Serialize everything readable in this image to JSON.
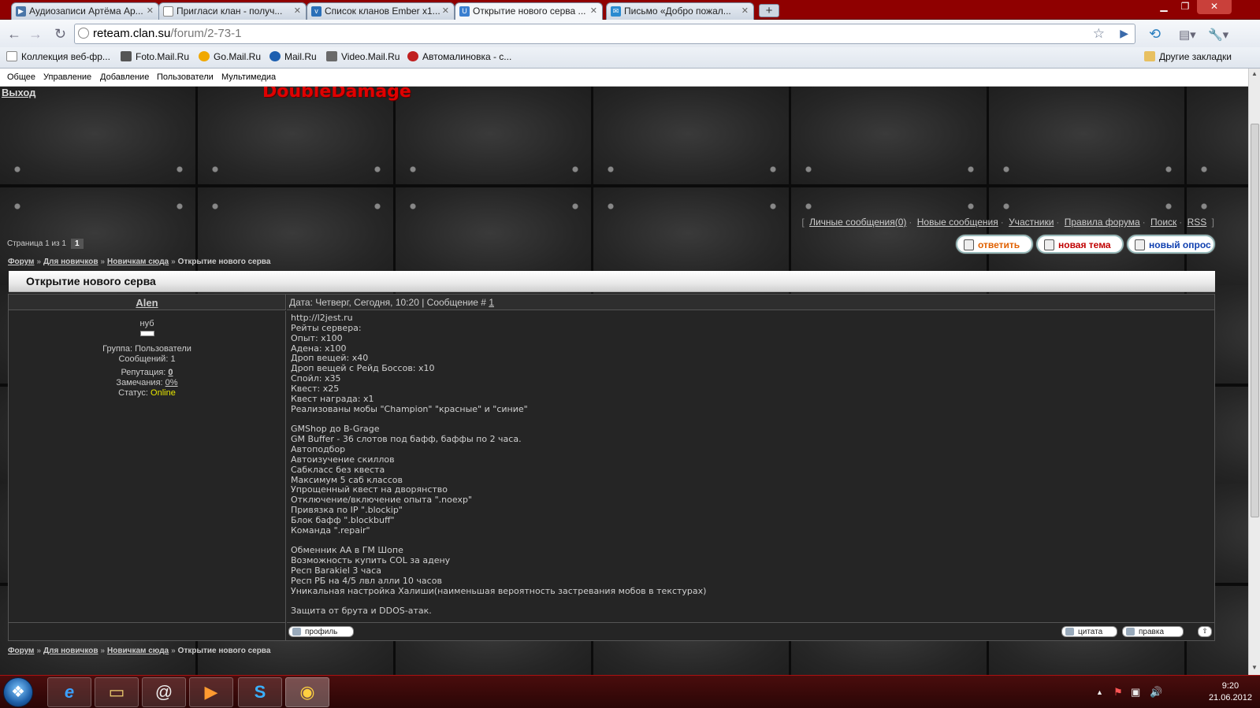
{
  "browser": {
    "tabs": [
      {
        "title": "Аудиозаписи Артёма Ар...",
        "icon": "vk-audio-icon",
        "color": "#4a76a8"
      },
      {
        "title": "Пригласи клан - получ...",
        "icon": "page-icon",
        "color": "#888888"
      },
      {
        "title": "Список кланов Ember x1...",
        "icon": "clan-icon",
        "color": "#2a6fb8"
      },
      {
        "title": "Открытие нового серва ...",
        "icon": "ucoz-icon",
        "color": "#3a7fd0"
      },
      {
        "title": "Письмо «Добро пожал...",
        "icon": "mail-icon",
        "color": "#2a8ad0"
      }
    ],
    "url_host": "reteam.clan.su",
    "url_path": "/forum/2-73-1",
    "bookmarks": [
      "Коллекция веб-фр...",
      "Foto.Mail.Ru",
      "Go.Mail.Ru",
      "Mail.Ru",
      "Video.Mail.Ru",
      "Автомалиновка - с..."
    ],
    "other_bookmarks": "Другие закладки"
  },
  "adminbar": {
    "items": [
      "Общее",
      "Управление",
      "Добавление",
      "Пользователи",
      "Мультимедиа"
    ]
  },
  "site": {
    "logout": "Выход",
    "title": "DoubleDamage",
    "userlinks": [
      "Личные сообщения(0)",
      "Новые сообщения",
      "Участники",
      "Правила форума",
      "Поиск",
      "RSS"
    ],
    "pager_label": "Страница 1 из 1",
    "pager_current": "1",
    "buttons": {
      "reply": "ответить",
      "new_topic": "новая тема",
      "new_poll": "новый опрос"
    },
    "breadcrumbs": [
      "Форум",
      "Для новичков",
      "Новичкам сюда",
      "Открытие нового серва"
    ]
  },
  "thread": {
    "title": "Открытие нового серва",
    "post": {
      "author": "Alen",
      "rank": "нуб",
      "group": "Группа: Пользователи",
      "messages": "Сообщений: 1",
      "reputation_label": "Репутация:",
      "reputation_value": "0",
      "warnings_label": "Замечания:",
      "warnings_value": "0%",
      "status_label": "Статус:",
      "status_value": "Online",
      "date_label": "Дата: Четверг, Сегодня, 10:20 | Сообщение #",
      "message_num": "1",
      "body": "http://l2jest.ru\nРейты сервера:\nОпыт: x100\nАдена: x100\nДроп вещей: x40\nДроп вещей с Рейд Боссов: x10\nСпойл: x35\nКвест: x25\nКвест награда: x1\nРеализованы мобы \"Champion\" \"красные\" и \"синие\"\n\nGMShop до B-Grage\nGM Buffer - 36 слотов под бафф, баффы по 2 часа.\nАвтоподбор\nАвтоизучение скиллов\nСабкласс без квеста\nМаксимум 5 саб классов\nУпрощенный квест на дворянство\nОтключение/включение опыта \".noexp\"\nПривязка по IP \".blockip\"\nБлок бафф \".blockbuff\"\nКоманда \".repair\"\n\nОбменник АА в ГМ Шопе\nВозможность купить COL за адену\nРесп Barakiel 3 часа\nРесп РБ на 4/5 лвл алли 10 часов\nУникальная настройка Халиши(наименьшая вероятность застревания мобов в текстурах)\n\nЗащита от брута и DDOS-атак.",
      "profile_btn": "профиль",
      "quote_btn": "цитата",
      "edit_btn": "правка"
    }
  },
  "taskbar": {
    "apps": [
      "internet-explorer-icon",
      "explorer-folder-icon",
      "mail-agent-icon",
      "media-player-icon",
      "skype-icon",
      "chrome-icon"
    ],
    "time": "9:20",
    "date": "21.06.2012"
  }
}
